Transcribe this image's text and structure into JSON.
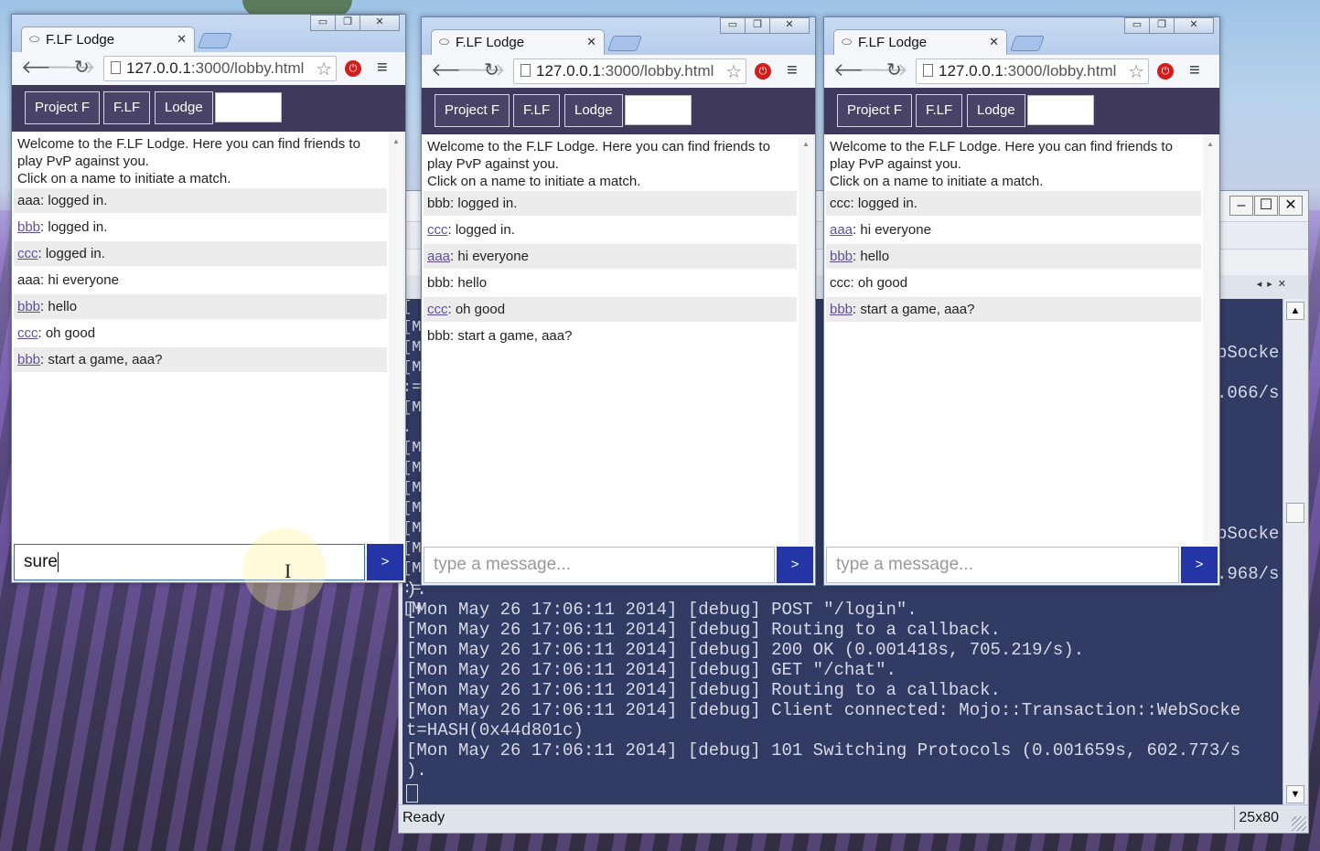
{
  "windows": [
    {
      "tab_title": "F.LF Lodge",
      "url_host": "127.0.0.1",
      "url_path": ":3000/lobby.html",
      "nav": [
        "Project F",
        "F.LF",
        "Lodge"
      ],
      "welcome_line1": "Welcome to the F.LF Lodge. Here you can find friends to",
      "welcome_line2": "play PvP against you.",
      "welcome_line3": "Click on a name to initiate a match.",
      "messages": [
        {
          "user": "aaa",
          "text": ": logged in.",
          "link": false
        },
        {
          "user": "bbb",
          "text": ": logged in.",
          "link": true
        },
        {
          "user": "ccc",
          "text": ": logged in.",
          "link": true
        },
        {
          "user": "aaa",
          "text": ": hi everyone",
          "link": false
        },
        {
          "user": "bbb",
          "text": ": hello",
          "link": true
        },
        {
          "user": "ccc",
          "text": ": oh good",
          "link": true
        },
        {
          "user": "bbb",
          "text": ": start a game, aaa?",
          "link": true
        }
      ],
      "input_value": "sure",
      "input_placeholder": "",
      "send_label": ">"
    },
    {
      "tab_title": "F.LF Lodge",
      "url_host": "127.0.0.1",
      "url_path": ":3000/lobby.html",
      "nav": [
        "Project F",
        "F.LF",
        "Lodge"
      ],
      "welcome_line1": "Welcome to the F.LF Lodge. Here you can find friends to",
      "welcome_line2": "play PvP against you.",
      "welcome_line3": "Click on a name to initiate a match.",
      "messages": [
        {
          "user": "bbb",
          "text": ": logged in.",
          "link": false
        },
        {
          "user": "ccc",
          "text": ": logged in.",
          "link": true
        },
        {
          "user": "aaa",
          "text": ": hi everyone",
          "link": true
        },
        {
          "user": "bbb",
          "text": ": hello",
          "link": false
        },
        {
          "user": "ccc",
          "text": ": oh good",
          "link": true
        },
        {
          "user": "bbb",
          "text": ": start a game, aaa?",
          "link": false
        }
      ],
      "input_value": "",
      "input_placeholder": "type a message...",
      "send_label": ">"
    },
    {
      "tab_title": "F.LF Lodge",
      "url_host": "127.0.0.1",
      "url_path": ":3000/lobby.html",
      "nav": [
        "Project F",
        "F.LF",
        "Lodge"
      ],
      "welcome_line1": "Welcome to the F.LF Lodge. Here you can find friends to",
      "welcome_line2": "play PvP against you.",
      "welcome_line3": "Click on a name to initiate a match.",
      "messages": [
        {
          "user": "ccc",
          "text": ": logged in.",
          "link": false
        },
        {
          "user": "aaa",
          "text": ": hi everyone",
          "link": true
        },
        {
          "user": "bbb",
          "text": ": hello",
          "link": true
        },
        {
          "user": "ccc",
          "text": ": oh good",
          "link": false
        },
        {
          "user": "bbb",
          "text": ": start a game, aaa?",
          "link": true
        }
      ],
      "input_value": "",
      "input_placeholder": "type a message...",
      "send_label": ">"
    }
  ],
  "terminal": {
    "side_fragments": [
      "bSocke",
      ".066/s",
      "bSocke",
      ".968/s"
    ],
    "left_fragments": [
      "[",
      "[M",
      "[M",
      "[M",
      ":=",
      "[M",
      ". ",
      "[M",
      "[M",
      "[M",
      "[M",
      "[M",
      "[M",
      "[M",
      ":=",
      "[M"
    ],
    "lines": [
      ").",
      "[Mon May 26 17:06:11 2014] [debug] POST \"/login\".",
      "[Mon May 26 17:06:11 2014] [debug] Routing to a callback.",
      "[Mon May 26 17:06:11 2014] [debug] 200 OK (0.001418s, 705.219/s).",
      "[Mon May 26 17:06:11 2014] [debug] GET \"/chat\".",
      "[Mon May 26 17:06:11 2014] [debug] Routing to a callback.",
      "[Mon May 26 17:06:11 2014] [debug] Client connected: Mojo::Transaction::WebSocke",
      "t=HASH(0x44d801c)",
      "[Mon May 26 17:06:11 2014] [debug] 101 Switching Protocols (0.001659s, 602.773/s",
      ")."
    ],
    "status": "Ready",
    "size": "25x80"
  }
}
